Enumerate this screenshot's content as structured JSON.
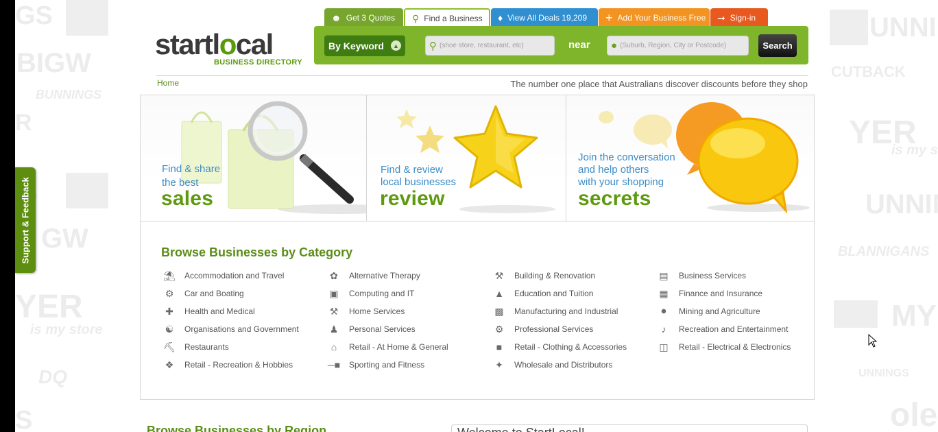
{
  "support_tab": {
    "label": "Support & Feedback"
  },
  "logo": {
    "part1": "startl",
    "part2": "o",
    "part3": "cal",
    "subtitle": "BUSINESS DIRECTORY"
  },
  "tabs": [
    {
      "label": "Get 3 Quotes",
      "icon": "quotes-icon"
    },
    {
      "label": "Find a Business",
      "icon": "search-icon"
    },
    {
      "label": "View All Deals 19,209",
      "icon": "tag-icon"
    },
    {
      "label": "Add Your Business Free",
      "icon": "plus-icon"
    },
    {
      "label": "Sign-in",
      "icon": "sign-in-icon"
    }
  ],
  "search": {
    "mode_label": "By Keyword",
    "keyword_placeholder": "(shoe store, restaurant, etc)",
    "near_label": "near",
    "location_placeholder": "(Suburb, Region, City or Postcode)",
    "button_label": "Search"
  },
  "breadcrumb": {
    "home": "Home"
  },
  "tagline": "The number one place that Australians discover discounts before they shop",
  "banners": [
    {
      "line1": "Find & share",
      "line2": "the best",
      "big": "sales"
    },
    {
      "line1": "Find & review",
      "line2": "local businesses",
      "big": "review"
    },
    {
      "line1": "Join the conversation",
      "line2": "and help others",
      "line3": "with your shopping",
      "big": "secrets"
    }
  ],
  "categories": {
    "title": "Browse Businesses by Category",
    "columns": [
      [
        {
          "label": "Accommodation and Travel",
          "icon": "beach-umbrella-icon"
        },
        {
          "label": "Car and Boating",
          "icon": "car-icon"
        },
        {
          "label": "Health and Medical",
          "icon": "medical-kit-icon"
        },
        {
          "label": "Organisations and Government",
          "icon": "government-building-icon"
        },
        {
          "label": "Restaurants",
          "icon": "cutlery-icon"
        },
        {
          "label": "Retail - Recreation & Hobbies",
          "icon": "puzzle-icon"
        }
      ],
      [
        {
          "label": "Alternative Therapy",
          "icon": "lotus-icon"
        },
        {
          "label": "Computing and IT",
          "icon": "computer-icon"
        },
        {
          "label": "Home Services",
          "icon": "tools-icon"
        },
        {
          "label": "Personal Services",
          "icon": "person-icon"
        },
        {
          "label": "Retail - At Home & General",
          "icon": "house-icon"
        },
        {
          "label": "Sporting and Fitness",
          "icon": "dumbbell-icon"
        }
      ],
      [
        {
          "label": "Building & Renovation",
          "icon": "wrench-hammer-icon"
        },
        {
          "label": "Education and Tuition",
          "icon": "graduation-cap-icon"
        },
        {
          "label": "Manufacturing and Industrial",
          "icon": "factory-icon"
        },
        {
          "label": "Professional Services",
          "icon": "gears-icon"
        },
        {
          "label": "Retail - Clothing & Accessories",
          "icon": "tshirt-icon"
        },
        {
          "label": "Wholesale and Distributors",
          "icon": "sparkle-icon"
        }
      ],
      [
        {
          "label": "Business Services",
          "icon": "briefcase-icon"
        },
        {
          "label": "Finance and Insurance",
          "icon": "calculator-icon"
        },
        {
          "label": "Mining and Agriculture",
          "icon": "tractor-icon"
        },
        {
          "label": "Recreation and Entertainment",
          "icon": "microphone-icon"
        },
        {
          "label": "Retail - Electrical & Electronics",
          "icon": "tv-icon"
        }
      ]
    ]
  },
  "region": {
    "title": "Browse Businesses by Region"
  },
  "welcome": {
    "text": "Welcome to StartLocal!"
  },
  "colors": {
    "brand_green": "#7fb52a",
    "dark_green": "#3f7d12",
    "blue": "#2f8fd0",
    "orange": "#f39321",
    "red_orange": "#e7591f"
  }
}
